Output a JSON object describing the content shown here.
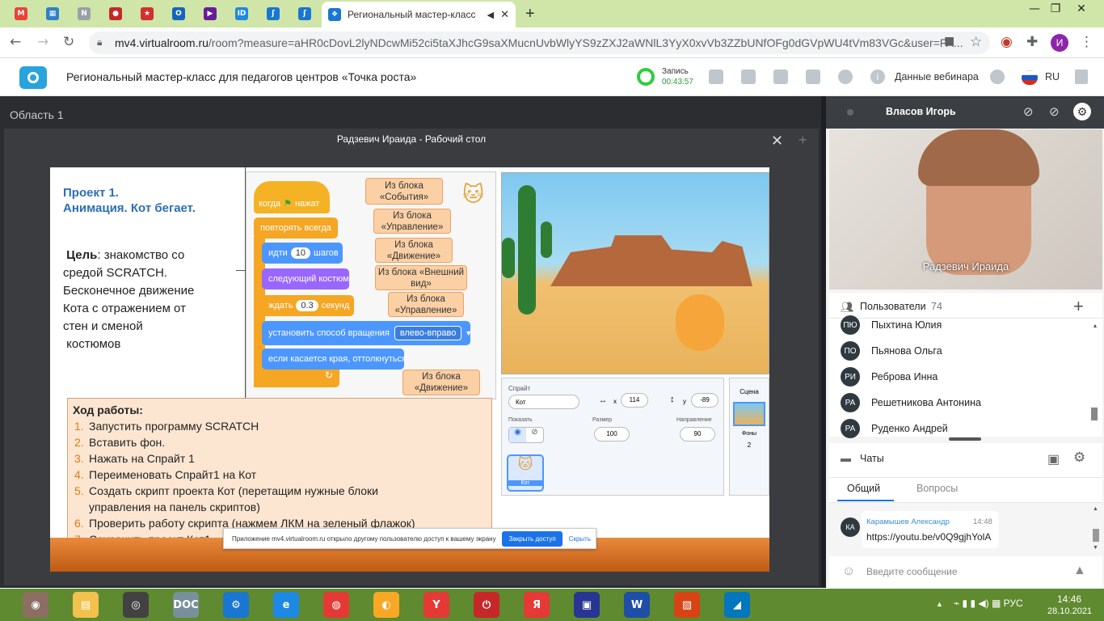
{
  "browser": {
    "pinned_tabs": [
      {
        "icon": "gmail-icon",
        "color": "#ea4335",
        "glyph": "M"
      },
      {
        "icon": "grid-app-icon",
        "color": "#2f80c8",
        "glyph": "▦"
      },
      {
        "icon": "chart-app-icon",
        "color": "#9aa0a6",
        "glyph": "N"
      },
      {
        "icon": "profile-app-icon",
        "color": "#c62828",
        "glyph": "●"
      },
      {
        "icon": "star-icon",
        "color": "#d32f2f",
        "glyph": "★"
      },
      {
        "icon": "outlook-icon",
        "color": "#1565c0",
        "glyph": "O"
      },
      {
        "icon": "media-app-icon",
        "color": "#6a1b9a",
        "glyph": "▶"
      },
      {
        "icon": "id-app-icon",
        "color": "#1e88e5",
        "glyph": "ID"
      },
      {
        "icon": "code-app-icon",
        "color": "#1976d2",
        "glyph": "ʃ"
      },
      {
        "icon": "code-app-icon-2",
        "color": "#1976d2",
        "glyph": "ʃ"
      }
    ],
    "active_tab_title": "Региональный мастер-класс",
    "url_domain": "mv4.virtualroom.ru",
    "url_rest": "/room?measure=aHR0cDovL2lyNDcwMi52ci5taXJhcG9saXMucnUvbWlyYS9zZXJ2aWNlL3YyX0xvVb3ZZbUNfOFg0dGVpWU4tVm83VGc&user=FA..."
  },
  "header": {
    "title": "Региональный мастер-класс для педагогов центров «Точка роста»",
    "recording_label": "Запись",
    "recording_time": "00:43:57",
    "webinar_data": "Данные вебинара",
    "lang": "RU"
  },
  "area": {
    "label": "Область 1",
    "window_title": "Радзевич Ираида - Рабочий стол"
  },
  "slide": {
    "project_title_1": "Проект 1.",
    "project_title_2": "Анимация. Кот бегает.",
    "goal_label": "Цель",
    "goal_text_1": ": знакомство со",
    "goal_text_2": "средой SCRATCH.",
    "goal_text_3": "Бесконечное движение",
    "goal_text_4": "Кота с отражением от",
    "goal_text_5": "стен и сменой",
    "goal_text_6": "костюмов",
    "blocks": {
      "when": "когда",
      "clicked": "нажат",
      "forever": "повторять всегда",
      "move": "идти",
      "move_value": "10",
      "move_unit": "шагов",
      "next_costume": "следующий костюм",
      "wait": "ждать",
      "wait_value": "0.3",
      "wait_unit": "секунд",
      "rotation": "установить способ вращения",
      "rotation_value": "влево-вправо",
      "bounce": "если касается края, оттолкнуться"
    },
    "notes": {
      "events": "Из блока «События»",
      "control1": "Из блока «Управление»",
      "motion1": "Из блока «Движение»",
      "looks": "Из блока «Внешний вид»",
      "control2": "Из блока «Управление»",
      "motion2": "Из блока «Движение»"
    },
    "sprite_panel": {
      "sprite_label": "Спрайт",
      "sprite_name": "Кот",
      "x_label": "x",
      "x_value": "114",
      "y_label": "y",
      "y_value": "-89",
      "show_label": "Показать",
      "size_label": "Размер",
      "size_value": "100",
      "direction_label": "Направление",
      "direction_value": "90",
      "thumb_label": "Кот",
      "stage_label": "Сцена",
      "backdrops_label": "Фоны",
      "backdrops_count": "2"
    },
    "work_title": "Ход работы:",
    "steps": [
      {
        "n": "1.",
        "t": "Запустить программу SCRATCH"
      },
      {
        "n": "2.",
        "t": "Вставить фон."
      },
      {
        "n": "3.",
        "t": "Нажать на Спрайт 1"
      },
      {
        "n": "4.",
        "t": "Переименовать  Спрайт1  на  Кот"
      },
      {
        "n": "5.",
        "t": "Создать  скрипт  проекта  Кот (перетащим  нужные  блоки"
      },
      {
        "n": "",
        "t": "управления на панель скриптов)"
      },
      {
        "n": "6.",
        "t": " Проверить  работу  скрипта  (нажмем ЛКМ на зеленый флажок)"
      },
      {
        "n": "7.",
        "t": "Сохранить проект Кот1"
      }
    ],
    "share_notice": "Приложение mv4.virtualroom.ru открыло другому пользователю доступ к вашему экрану",
    "stop_sharing": "Закрыть доступ",
    "hide": "Скрыть"
  },
  "video": {
    "host_name": "Власов Игорь",
    "presenter": "Радзевич Ираида"
  },
  "users": {
    "label": "Пользователи",
    "count": "74",
    "list": [
      {
        "initials": "ПЮ",
        "name": "Пыхтина Юлия"
      },
      {
        "initials": "ПО",
        "name": "Пьянова Ольга"
      },
      {
        "initials": "РИ",
        "name": "Реброва Инна"
      },
      {
        "initials": "РА",
        "name": "Решетникова Антонина"
      },
      {
        "initials": "РА",
        "name": "Руденко Андрей"
      }
    ]
  },
  "chats": {
    "label": "Чаты",
    "tab_general": "Общий",
    "tab_questions": "Вопросы",
    "msg_initials": "КА",
    "msg_author": "Карамышев Александр",
    "msg_time": "14:48",
    "msg_text": "https://youtu.be/v0Q9gjhYolA",
    "input_placeholder": "Введите сообщение"
  },
  "taskbar": {
    "time": "14:46",
    "date": "28.10.2021",
    "apps": [
      {
        "name": "taskbar-app-1",
        "glyph": "◉",
        "color": "#8d6e63"
      },
      {
        "name": "file-explorer-icon",
        "glyph": "▤",
        "color": "#f2c14e"
      },
      {
        "name": "speaker-app-icon",
        "glyph": "◎",
        "color": "#424242"
      },
      {
        "name": "document-app-icon",
        "glyph": "DOC",
        "color": "#78909c"
      },
      {
        "name": "settings-app-icon",
        "glyph": "⚙",
        "color": "#1976d2"
      },
      {
        "name": "internet-explorer-icon",
        "glyph": "e",
        "color": "#1e88e5"
      },
      {
        "name": "chrome-icon",
        "glyph": "◍",
        "color": "#e53935"
      },
      {
        "name": "vpn-app-icon",
        "glyph": "◐",
        "color": "#f9a825"
      },
      {
        "name": "yandex-browser-icon",
        "glyph": "Y",
        "color": "#e53935"
      },
      {
        "name": "power-app-icon",
        "glyph": "⏻",
        "color": "#c62828"
      },
      {
        "name": "yandex-icon",
        "glyph": "Я",
        "color": "#e53935"
      },
      {
        "name": "save-app-icon",
        "glyph": "▣",
        "color": "#283593"
      },
      {
        "name": "word-icon",
        "glyph": "W",
        "color": "#1e4ea8"
      },
      {
        "name": "presentation-icon",
        "glyph": "▨",
        "color": "#d84315"
      },
      {
        "name": "cloud-app-icon",
        "glyph": "◢",
        "color": "#0277bd"
      }
    ]
  }
}
